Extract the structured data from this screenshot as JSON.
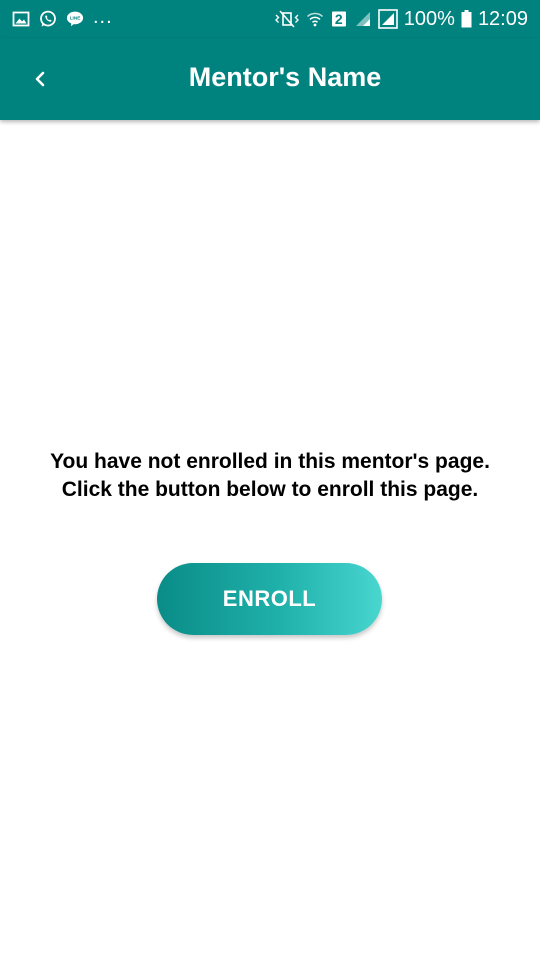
{
  "status_bar": {
    "notification_icons": [
      "image-icon",
      "whatsapp-icon",
      "line-icon"
    ],
    "overflow_text": "...",
    "right_icons": [
      "vibrate-icon",
      "wifi-icon",
      "sim-icon",
      "signal-icon",
      "signal-icon"
    ],
    "sim_label": "2",
    "battery_text": "100%",
    "time": "12:09"
  },
  "app_bar": {
    "title": "Mentor's Name",
    "back_icon": "back-icon"
  },
  "main": {
    "message": "You have not enrolled in this mentor's page. Click the button below to enroll this page.",
    "enroll_label": "ENROLL"
  },
  "colors": {
    "primary": "#00827F",
    "button_gradient_start": "#0A8C87",
    "button_gradient_end": "#48D6CF",
    "background": "#FFFFFF",
    "text": "#000000"
  }
}
